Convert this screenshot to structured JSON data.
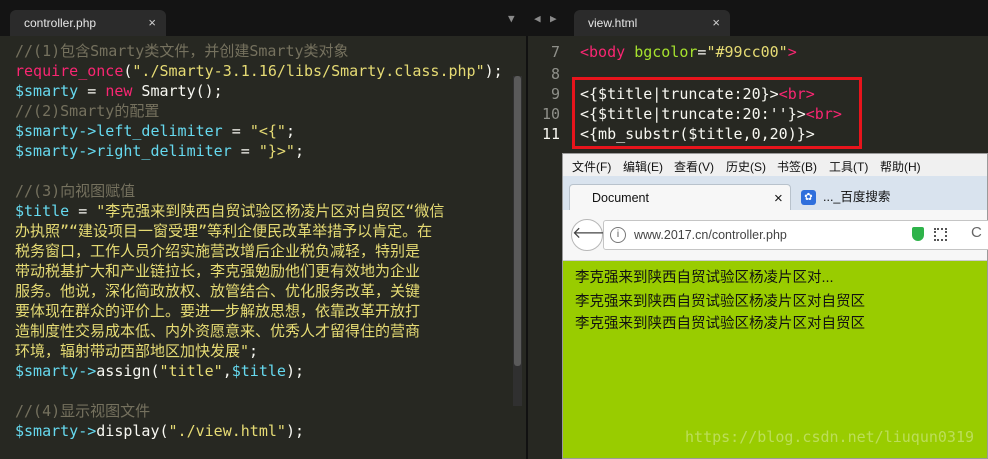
{
  "left_tab": {
    "title": "controller.php",
    "close": "×"
  },
  "right_tab": {
    "title": "view.html",
    "close": "×"
  },
  "nav_arrows": {
    "prev": "◀",
    "next": "▶",
    "menu": "▼"
  },
  "php": {
    "l1": "//(1)包含Smarty类文件，并创建Smarty类对象",
    "l2a": "require_once",
    "l2b": "(",
    "l2c": "\"./Smarty-3.1.16/libs/Smarty.class.php\"",
    "l2d": ");",
    "l3a": "$smarty",
    "l3b": " = ",
    "l3c": "new",
    "l3d": " Smarty();",
    "l4": "//(2)Smarty的配置",
    "l5a": "$smarty->",
    "l5b": "left_delimiter",
    "l5c": " = ",
    "l5d": "\"<{\"",
    "l5e": ";",
    "l6a": "$smarty->",
    "l6b": "right_delimiter",
    "l6c": " = ",
    "l6d": "\"}>\"",
    "l6e": ";",
    "l8": "//(3)向视图赋值",
    "l9a": "$title",
    "l9b": " = ",
    "l9c": "\"李克强来到陕西自贸试验区杨凌片区对自贸区“微信",
    "l10": "办执照”“建设项目一窗受理”等利企便民改革举措予以肯定。在",
    "l11": "税务窗口，工作人员介绍实施营改增后企业税负减轻，特别是",
    "l12": "带动税基扩大和产业链拉长，李克强勉励他们更有效地为企业",
    "l13": "服务。他说，深化简政放权、放管结合、优化服务改革，关键",
    "l14": "要体现在群众的评价上。要进一步解放思想，依靠改革开放打",
    "l15": "造制度性交易成本低、内外资愿意来、优秀人才留得住的营商",
    "l16a": "环境，辐射带动西部地区加快发展\"",
    "l16b": ";",
    "l17a": "$smarty->",
    "l17b": "assign(",
    "l17c": "\"title\"",
    "l17d": ",",
    "l17e": "$title",
    "l17f": ");",
    "l19": "//(4)显示视图文件",
    "l20a": "$smarty->",
    "l20b": "display(",
    "l20c": "\"./view.html\"",
    "l20d": ");"
  },
  "html": {
    "lines": [
      "7",
      "8",
      "9",
      "10",
      "11"
    ],
    "l7a": "<body ",
    "l7b": "bgcolor",
    "l7c": "=",
    "l7d": "\"#99cc00\"",
    "l7e": ">",
    "l9a": "<{$title|truncate:20}>",
    "l9b": "<br>",
    "l10a": "<{$title|truncate:20:''}>",
    "l10b": "<br>",
    "l11": "<{mb_substr($title,0,20)}>"
  },
  "browser": {
    "menu": [
      "文件(F)",
      "编辑(E)",
      "查看(V)",
      "历史(S)",
      "书签(B)",
      "工具(T)",
      "帮助(H)"
    ],
    "tab_active": "Document",
    "tab_close": "×",
    "tab_other": "..._百度搜索",
    "url": "www.2017.cn/controller.php",
    "output": [
      "李克强来到陕西自贸试验区杨凌片区对...",
      "李克强来到陕西自贸试验区杨凌片区对自贸区",
      "李克强来到陕西自贸试验区杨凌片区对自贸区"
    ],
    "bg_color": "#99cc00"
  },
  "watermark": "https://blog.csdn.net/liuqun0319",
  "colors": {
    "highlight_box": "#e8141c"
  }
}
